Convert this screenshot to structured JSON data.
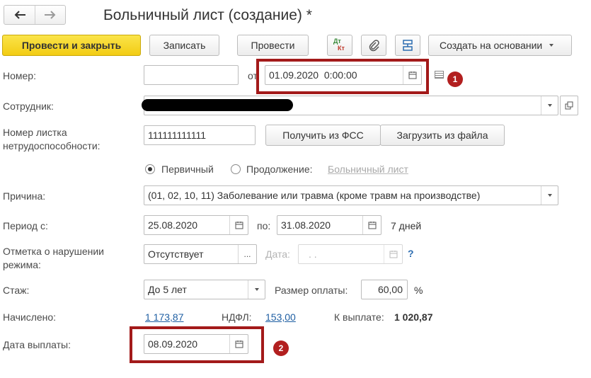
{
  "window": {
    "title": "Больничный лист (создание) *"
  },
  "toolbar": {
    "post_close": "Провести и закрыть",
    "save": "Записать",
    "post": "Провести",
    "dt_label": "Дт",
    "kt_label": "Кт",
    "create_based_on": "Создать на основании"
  },
  "form": {
    "number_label": "Номер:",
    "number_value": "",
    "date_from_label": "от",
    "date_value": "01.09.2020  0:00:00",
    "employee_label": "Сотрудник:",
    "sheet_number_label_1": "Номер листка",
    "sheet_number_label_2": "нетрудоспособности:",
    "sheet_number_value": "111111111111",
    "get_fss_button": "Получить из ФСС",
    "load_file_button": "Загрузить из файла",
    "radio_primary": "Первичный",
    "radio_continuation": "Продолжение:",
    "continuation_link": "Больничный лист",
    "reason_label": "Причина:",
    "reason_value": "(01, 02, 10, 11) Заболевание или травма (кроме травм на производстве)",
    "period_label": "Период с:",
    "period_from": "25.08.2020",
    "period_to_label": "по:",
    "period_to": "31.08.2020",
    "period_days": "7 дней",
    "violation_label_1": "Отметка о нарушении",
    "violation_label_2": "режима:",
    "violation_value": "Отсутствует",
    "violation_ellipsis": "...",
    "violation_date_label": "Дата:",
    "violation_date_value": ". .",
    "help_mark": "?",
    "experience_label": "Стаж:",
    "experience_value": "До 5 лет",
    "payment_size_label": "Размер оплаты:",
    "payment_size_value": "60,00",
    "percent_sign": "%",
    "accrued_label": "Начислено:",
    "accrued_value": "1 173,87",
    "ndfl_label": "НДФЛ:",
    "ndfl_value": "153,00",
    "to_pay_label": "К выплате:",
    "to_pay_value": "1 020,87",
    "pay_date_label": "Дата выплаты:",
    "pay_date_value": "08.09.2020"
  },
  "annotations": {
    "badge_1": "1",
    "badge_2": "2"
  },
  "colors": {
    "accent_yellow": "#f2cc13",
    "annotation_red": "#a31a1a",
    "link_blue": "#1f5fa3"
  }
}
